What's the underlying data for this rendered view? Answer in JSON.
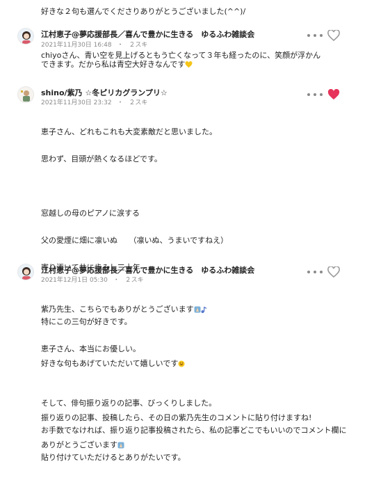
{
  "top_text": "好きな２句も選んでくださりありがとうございました(^^)/",
  "comments": [
    {
      "author": "江村恵子@夢応援部長／喜んで豊かに生きる　ゆるふわ雑談会",
      "date": "2021年11月30日 16:48",
      "separator": "・",
      "likes": "２スキ",
      "liked": false,
      "text": "chiyoさん、青い空を見上げるともう亡くなって３年も経ったのに、笑顔が浮かんできます。だから私は青空大好きなんです"
    },
    {
      "author": "shino/紫乃 ☆冬ピリカグランプリ☆",
      "date": "2021年11月30日 23:32",
      "separator": "・",
      "likes": "２スキ",
      "liked": true,
      "lines": [
        "恵子さん、どれもこれも大変素敵だと思いました。",
        "思わず、目頭が熱くなるほどです。",
        "",
        "窓越しの母のピアノに涙する",
        "父の愛煙に畑に凛いぬ　　（凛いぬ、うまいですねえ）",
        "寄り添いて共に歩みし三十年",
        "",
        "特にこの三句が好きです。",
        "恵子さん、本当にお優しい。",
        "",
        "そして、俳句振り返りの記事、びっくりしました。",
        "お手数でなければ、振り返り記事投稿されたら、私の記事どこでもいいのでコメント欄に",
        "貼り付けていただけるとありがたいです。"
      ]
    },
    {
      "author": "江村恵子@夢応援部長／喜んで豊かに生きる　ゆるふわ雑談会",
      "date": "2021年12月1日 05:30",
      "separator": "・",
      "likes": "２スキ",
      "liked": false,
      "lines": [
        "紫乃先生、こちらでもありがとうございます",
        "",
        "好きな句もあげていただいて嬉しいです",
        "",
        "振り返りの記事、投稿したら、その日の紫乃先生のコメントに貼り付けますね!",
        "ありがとうございます"
      ]
    }
  ],
  "colors": {
    "like_active": "#e6345a",
    "like_inactive": "#9a9a9a",
    "meta": "#8a8a8a"
  },
  "icons": [
    "avatar-keiko-icon",
    "avatar-shino-icon",
    "more-icon",
    "heart-icon",
    "yellow-heart-emoji",
    "grinning-emoji",
    "praying-emoji",
    "music-note-emoji"
  ]
}
